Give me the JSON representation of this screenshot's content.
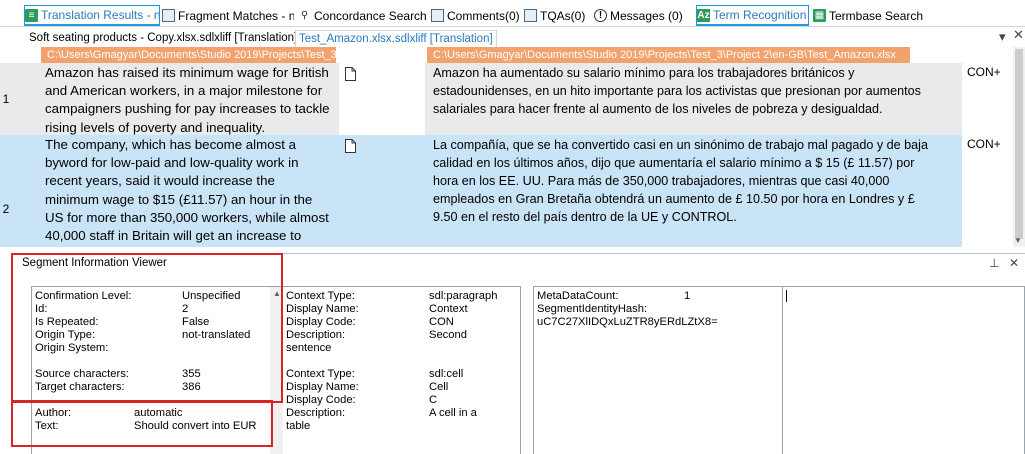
{
  "top_tabs": [
    {
      "label": "Translation Results - n...",
      "icon": "green-results-icon"
    },
    {
      "label": "Fragment Matches - n...",
      "icon": "fragment-icon"
    },
    {
      "label": "Concordance Search",
      "icon": "concordance-icon"
    },
    {
      "label": "Comments(0)",
      "icon": "comments-icon"
    },
    {
      "label": "TQAs(0)",
      "icon": "tqa-icon"
    },
    {
      "label": "Messages (0)",
      "icon": "info-icon"
    },
    {
      "label": "Term Recognition",
      "icon": "term-icon"
    },
    {
      "label": "Termbase Search",
      "icon": "termbase-icon"
    }
  ],
  "doc_tabs": [
    {
      "label": "Soft seating products - Copy.xlsx.sdlxliff [Translation]"
    },
    {
      "label": "Test_Amazon.xlsx.sdlxliff [Translation]"
    }
  ],
  "editor": {
    "source_path": "C:\\Users\\Gmagyar\\Documents\\Studio 2019\\Projects\\Test_3\\",
    "target_path": "C:\\Users\\Gmagyar\\Documents\\Studio 2019\\Projects\\Test_3\\Project 2\\en-GB\\Test_Amazon.xlsx",
    "segments": [
      {
        "num": "1",
        "source": [
          "Amazon has raised its minimum wage for British",
          "and American workers, in a major milestone for",
          "campaigners pushing for pay increases to tackle",
          "rising levels of poverty and inequality."
        ],
        "target": [
          "Amazon ha aumentado su salario mínimo para los trabajadores británicos y",
          "estadounidenses, en un hito importante para los activistas que presionan por aumentos",
          "salariales para hacer frente al aumento de los niveles de pobreza y desigualdad."
        ],
        "status": "CON+"
      },
      {
        "num": "2",
        "source": [
          "The company, which has become almost a",
          "byword for low-paid and low-quality work in",
          "recent years, said it would increase the",
          "minimum wage to $15 (£11.57) an hour in the",
          "US for more than 350,000 workers, while almost",
          "40,000 staff in Britain will get an increase to"
        ],
        "target": [
          "La compañía, que se ha convertido casi en un sinónimo de trabajo mal pagado y de baja",
          "calidad en los últimos años, dijo que aumentaría el salario mínimo a $ 15 (£ 11.57) por",
          "hora en los EE. UU. Para más de 350,000 trabajadores, mientras que casi 40,000",
          "empleados en Gran Bretaña obtendrá un aumento de £ 10.50 por hora en Londres y £",
          "9.50 en el resto del país dentro de la UE y CONTROL."
        ],
        "status": "CON+"
      }
    ]
  },
  "panel": {
    "title": "Segment Information Viewer",
    "box1": {
      "rows": [
        {
          "k": "Confirmation Level:",
          "v": "Unspecified"
        },
        {
          "k": "Id:",
          "v": "2"
        },
        {
          "k": "Is Repeated:",
          "v": "False"
        },
        {
          "k": "Origin Type:",
          "v": "not-translated"
        },
        {
          "k": "Origin System:",
          "v": ""
        }
      ],
      "chars": [
        {
          "k": "Source characters:",
          "v": "355"
        },
        {
          "k": "Target characters:",
          "v": "386"
        }
      ],
      "comment": [
        {
          "k": "Author:",
          "v": "automatic"
        },
        {
          "k": "Text:",
          "v": "Should convert into EUR"
        }
      ]
    },
    "box2": {
      "group1": [
        {
          "k": "Context Type:",
          "v": "sdl:paragraph"
        },
        {
          "k": "Display Name:",
          "v": "Context"
        },
        {
          "k": "Display Code:",
          "v": "CON"
        },
        {
          "k": "Description:",
          "v": "Second"
        }
      ],
      "group1_extra": "sentence",
      "group2": [
        {
          "k": "Context Type:",
          "v": "sdl:cell"
        },
        {
          "k": "Display Name:",
          "v": "Cell"
        },
        {
          "k": "Display Code:",
          "v": "C"
        },
        {
          "k": "Description:",
          "v": "A cell in a"
        }
      ],
      "group2_extra": "table"
    },
    "box3": {
      "meta_label": "MetaDataCount:",
      "meta_value": "1",
      "hash_label": "SegmentIdentityHash:",
      "hash_value": "uC7C27XlIDQxLuZTR8yERdLZtX8="
    }
  }
}
